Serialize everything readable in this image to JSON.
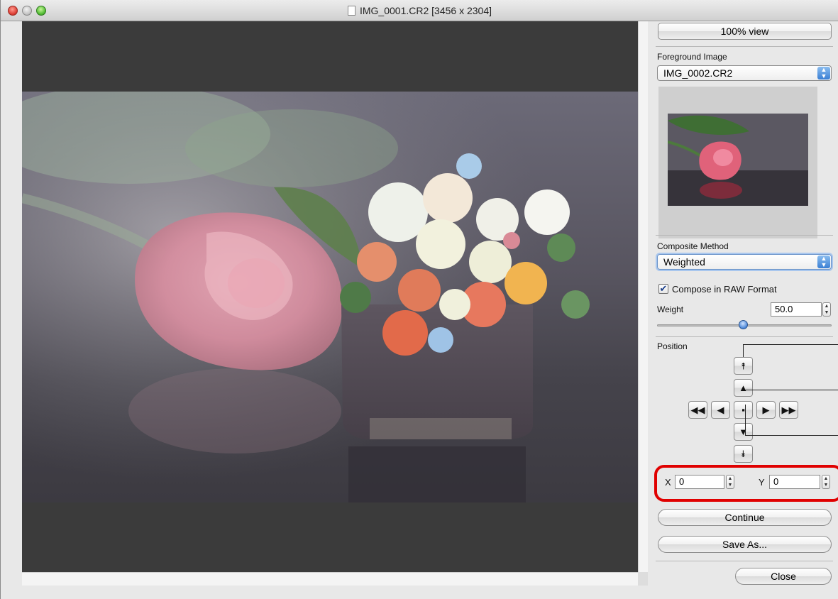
{
  "window": {
    "title": "IMG_0001.CR2 [3456 x 2304]"
  },
  "panel": {
    "view_button": "100% view",
    "foreground_label": "Foreground Image",
    "foreground_value": "IMG_0002.CR2",
    "composite_label": "Composite Method",
    "composite_value": "Weighted",
    "raw_checkbox_label": "Compose in RAW Format",
    "raw_checked": true,
    "weight_label": "Weight",
    "weight_value": "50.0",
    "weight_slider_fraction": 0.5,
    "position_label": "Position",
    "x_label": "X",
    "x_value": "0",
    "y_label": "Y",
    "y_value": "0",
    "continue_button": "Continue",
    "save_as_button": "Save As...",
    "close_button": "Close"
  },
  "icons": {
    "up_fast": "⯭",
    "up": "▲",
    "down": "▼",
    "down_fast": "⯯",
    "left_fast": "◀◀",
    "left": "◀",
    "center": "▪",
    "right": "▶",
    "right_fast": "▶▶",
    "checkmark": "✔",
    "select_arrows_up": "▲",
    "select_arrows_down": "▼"
  },
  "colors": {
    "highlight": "#e00000",
    "select_accent": "#3a7fd4"
  }
}
